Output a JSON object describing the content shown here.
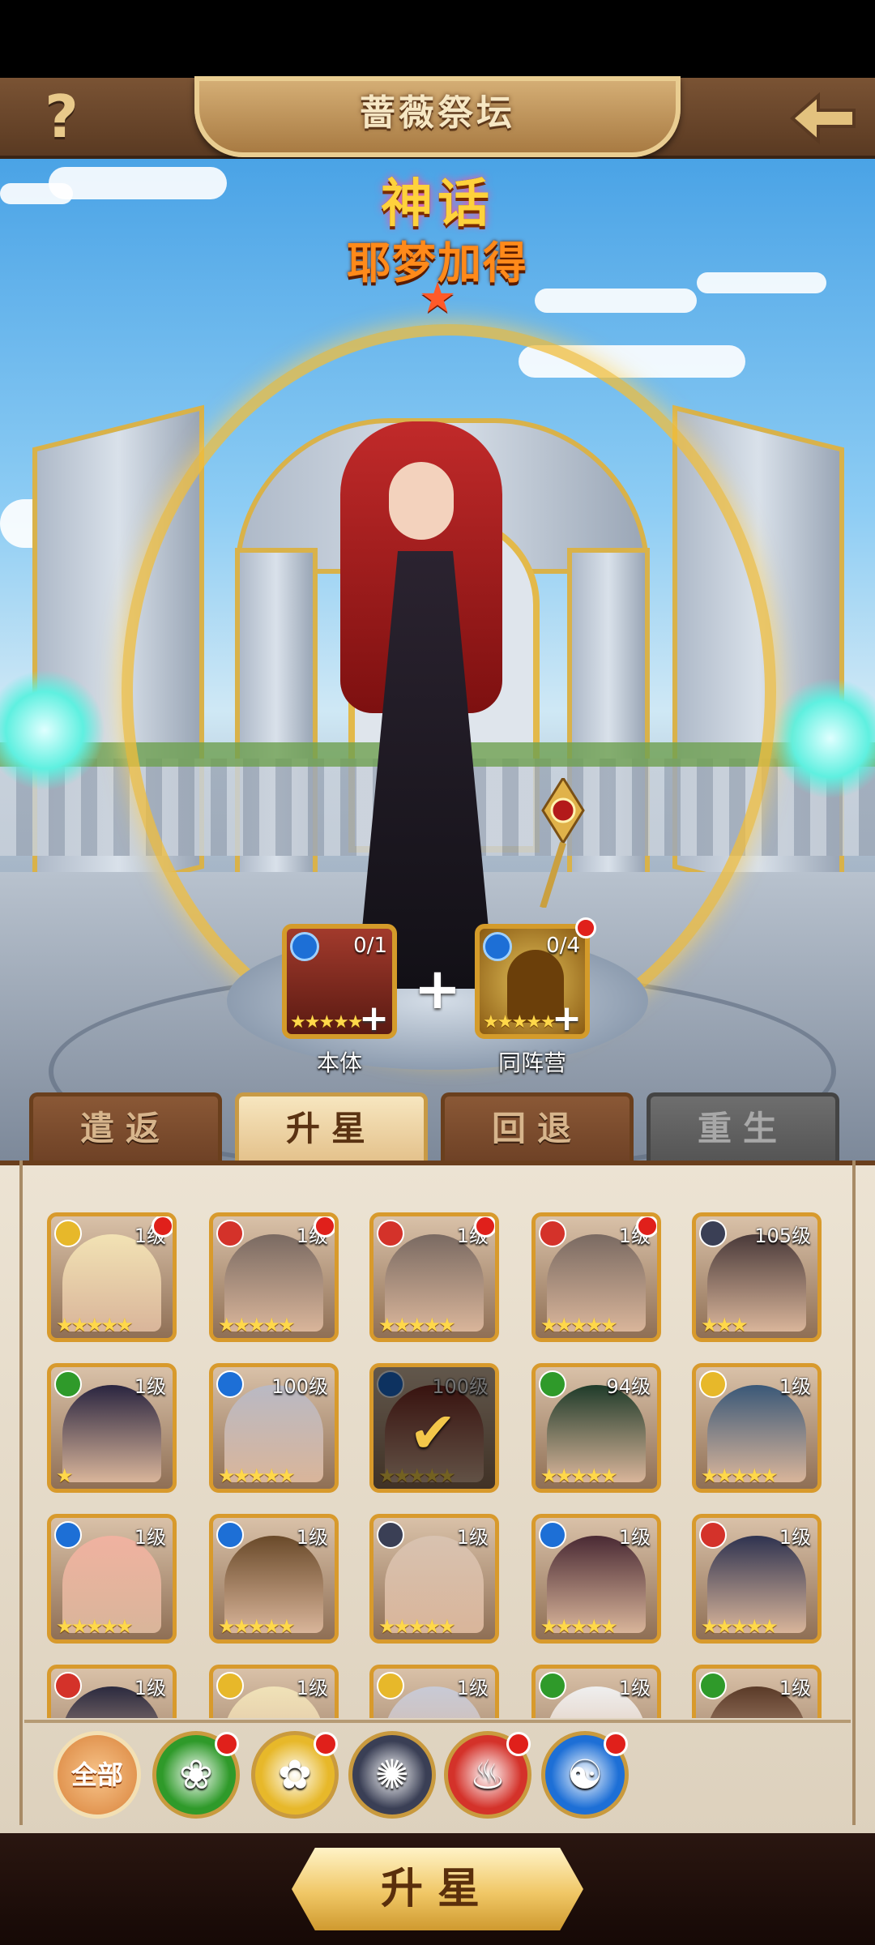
{
  "header": {
    "help_label": "?",
    "title": "蔷薇祭坛"
  },
  "hero": {
    "rarity": "神话",
    "name": "耶梦加得",
    "star": "★"
  },
  "materials": [
    {
      "label": "本体",
      "count": "0/1",
      "stars": "★★★★★"
    },
    {
      "label": "同阵营",
      "count": "0/4",
      "stars": "★★★★★"
    }
  ],
  "plus_sign": "+",
  "tabs": [
    {
      "label": "遣返",
      "state": "off"
    },
    {
      "label": "升星",
      "state": "on"
    },
    {
      "label": "回退",
      "state": "off"
    },
    {
      "label": "重生",
      "state": "disabled"
    }
  ],
  "cards": [
    {
      "level": "1级",
      "stars": "★★★★★",
      "faction": "rose",
      "dot": true,
      "selected": false
    },
    {
      "level": "1级",
      "stars": "★★★★★",
      "faction": "fire",
      "dot": true,
      "selected": false
    },
    {
      "level": "1级",
      "stars": "★★★★★",
      "faction": "fire",
      "dot": true,
      "selected": false
    },
    {
      "level": "1级",
      "stars": "★★★★★",
      "faction": "fire",
      "dot": true,
      "selected": false
    },
    {
      "level": "105级",
      "stars": "★★★",
      "faction": "star",
      "dot": false,
      "selected": false
    },
    {
      "level": "1级",
      "stars": "★",
      "faction": "nature",
      "dot": false,
      "selected": false
    },
    {
      "level": "100级",
      "stars": "★★★★★",
      "faction": "water",
      "dot": false,
      "selected": false
    },
    {
      "level": "100级",
      "stars": "★★★★★",
      "faction": "water",
      "dot": false,
      "selected": true
    },
    {
      "level": "94级",
      "stars": "★★★★★",
      "faction": "nature",
      "dot": false,
      "selected": false
    },
    {
      "level": "1级",
      "stars": "★★★★★",
      "faction": "rose",
      "dot": false,
      "selected": false
    },
    {
      "level": "1级",
      "stars": "★★★★★",
      "faction": "water",
      "dot": false,
      "selected": false
    },
    {
      "level": "1级",
      "stars": "★★★★★",
      "faction": "water",
      "dot": false,
      "selected": false
    },
    {
      "level": "1级",
      "stars": "★★★★★",
      "faction": "star",
      "dot": false,
      "selected": false
    },
    {
      "level": "1级",
      "stars": "★★★★★",
      "faction": "water",
      "dot": false,
      "selected": false
    },
    {
      "level": "1级",
      "stars": "★★★★★",
      "faction": "fire",
      "dot": false,
      "selected": false
    },
    {
      "level": "1级",
      "stars": "",
      "faction": "fire",
      "dot": false,
      "selected": false
    },
    {
      "level": "1级",
      "stars": "",
      "faction": "rose",
      "dot": false,
      "selected": false
    },
    {
      "level": "1级",
      "stars": "",
      "faction": "rose",
      "dot": false,
      "selected": false
    },
    {
      "level": "1级",
      "stars": "",
      "faction": "nature",
      "dot": false,
      "selected": false
    },
    {
      "level": "1级",
      "stars": "",
      "faction": "nature",
      "dot": false,
      "selected": false
    }
  ],
  "filters": [
    {
      "name": "all",
      "label": "全部"
    },
    {
      "name": "nature",
      "label": ""
    },
    {
      "name": "rose",
      "label": ""
    },
    {
      "name": "star",
      "label": ""
    },
    {
      "name": "fire",
      "label": ""
    },
    {
      "name": "water",
      "label": ""
    }
  ],
  "main_button": {
    "label": "升星"
  },
  "colors": {
    "fire": "#d4322a",
    "water": "#1d6fd6",
    "nature": "#2f9a2a",
    "rose": "#e7b82a",
    "star": "#3a3f55",
    "gold_border": "#d89a2c"
  }
}
